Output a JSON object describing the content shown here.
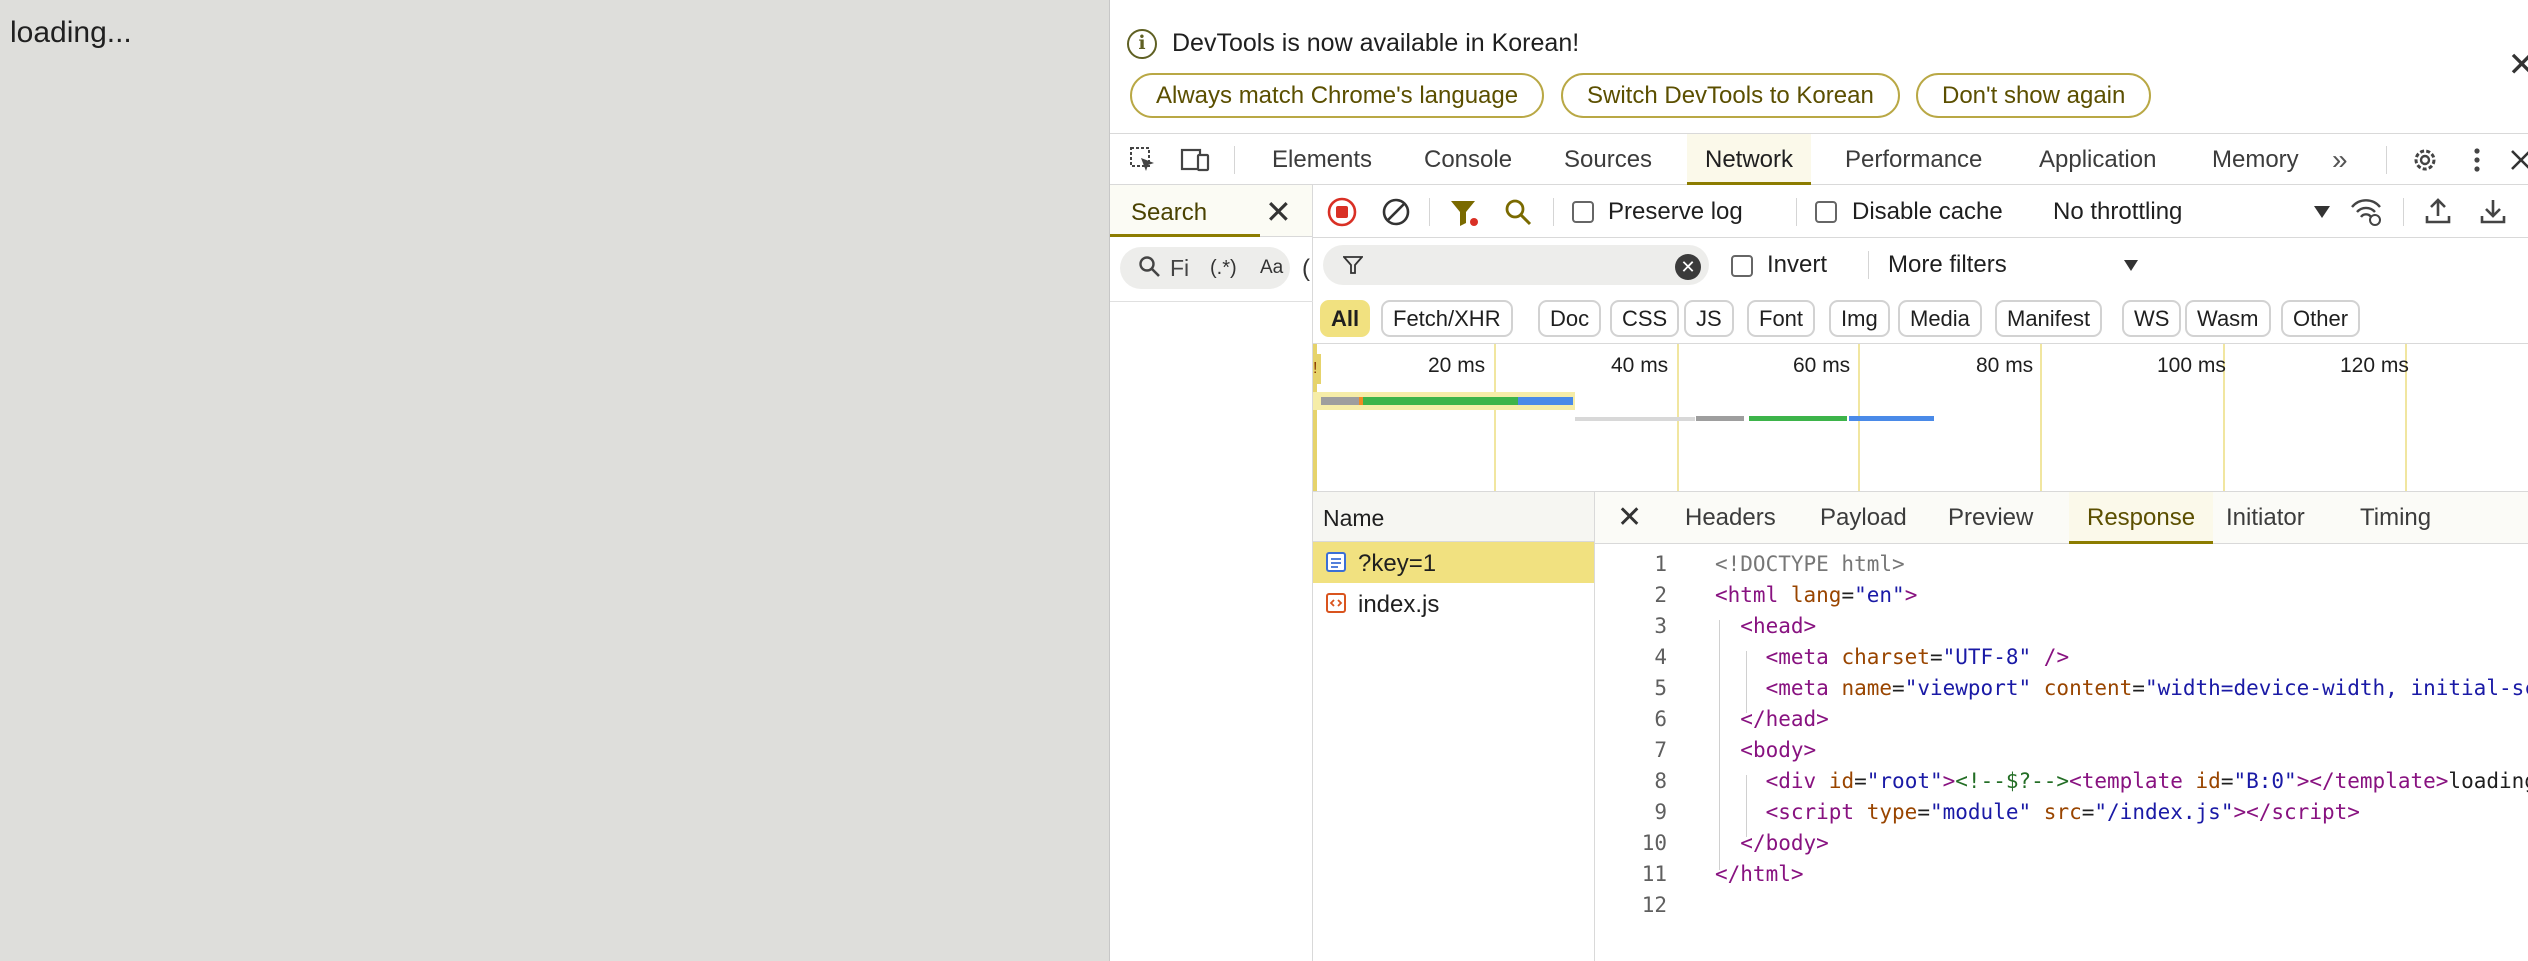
{
  "page": {
    "loading_text": "loading..."
  },
  "infobar": {
    "message": "DevTools is now available in Korean!",
    "buttons": [
      "Always match Chrome's language",
      "Switch DevTools to Korean",
      "Don't show again"
    ]
  },
  "tabs": [
    "Elements",
    "Console",
    "Sources",
    "Network",
    "Performance",
    "Application",
    "Memory"
  ],
  "active_tab": "Network",
  "search": {
    "label": "Search",
    "value": "Fi",
    "regex": "(.*)",
    "case": "Aa"
  },
  "toolbar": {
    "preserve_log": "Preserve log",
    "disable_cache": "Disable cache",
    "throttling": "No throttling"
  },
  "filter": {
    "invert": "Invert",
    "more_filters": "More filters",
    "types": [
      "All",
      "Fetch/XHR",
      "Doc",
      "CSS",
      "JS",
      "Font",
      "Img",
      "Media",
      "Manifest",
      "WS",
      "Wasm",
      "Other"
    ]
  },
  "timeline": {
    "ticks": [
      "20 ms",
      "40 ms",
      "60 ms",
      "80 ms",
      "100 ms",
      "120 ms"
    ]
  },
  "requests": {
    "header": "Name",
    "items": [
      "?key=1",
      "index.js"
    ]
  },
  "details": {
    "tabs": [
      "Headers",
      "Payload",
      "Preview",
      "Response",
      "Initiator",
      "Timing"
    ],
    "active": "Response",
    "lines": [
      "1",
      "2",
      "3",
      "4",
      "5",
      "6",
      "7",
      "8",
      "9",
      "10",
      "11",
      "12"
    ]
  },
  "colors": {
    "accent": "#8c7c00",
    "selection": "#f1e180",
    "stop": "#d93025"
  }
}
